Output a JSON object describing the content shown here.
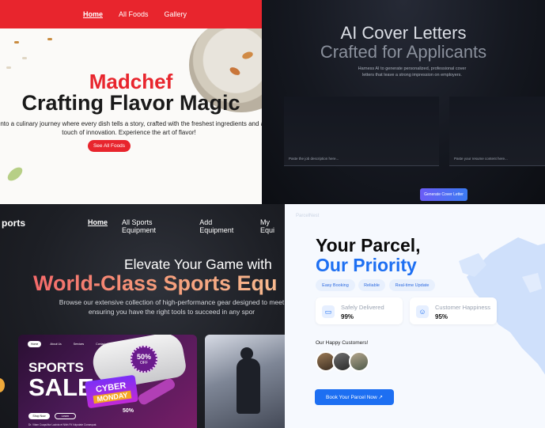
{
  "madchef": {
    "nav": [
      "Home",
      "All Foods",
      "Gallery"
    ],
    "title_line1": "Madchef",
    "title_line2": "Crafting Flavor Magic",
    "description": "e into a culinary journey where every dish tells a story, crafted with the freshest ingredients and a touch of innovation. Experience the art of flavor!",
    "cta": "See All Foods",
    "accent": "#e8252d"
  },
  "cover": {
    "title_line1": "AI Cover Letters",
    "title_line2": "Crafted for Applicants",
    "subtitle": "Harness AI to generate personalized, professional cover letters that leave a strong impression on employers.",
    "job_placeholder": "Paste the job description here...",
    "resume_placeholder": "Paste your resume content here...",
    "cta": "Generate Cover Letter"
  },
  "sports": {
    "brand": "ports",
    "nav": [
      "Home",
      "All Sports Equipment",
      "Add Equipment",
      "My Equi"
    ],
    "heading1": "Elevate Your Game with",
    "heading2": "World-Class Sports Equ",
    "description_line1": "Browse our extensive collection of high-performance gear designed to meet",
    "description_line2": "ensuring you have the right tools to succeed in any spor",
    "card": {
      "mini_nav": [
        "Home",
        "About Us",
        "Services",
        "Contact"
      ],
      "line1": "SPORTS",
      "line2": "SALE",
      "badge_value": "50%",
      "badge_label": "OFF",
      "cyber": "CYBER",
      "monday": "MONDAY",
      "discount": "50%",
      "cta1": "Shop Now",
      "cta2": "Learn",
      "fine": "Dr. Vitam Cuapulitur Lacinia et Nibh Fit Vulputate Consequat."
    }
  },
  "parcel": {
    "brand": "ParcelNest",
    "title_line1": "Your Parcel,",
    "title_line2": "Our Priority",
    "chips": [
      "Easy Booking",
      "Reliable",
      "Real-time Update"
    ],
    "stats": [
      {
        "label": "Safely Delivered",
        "value": "99%",
        "icon": "truck-icon"
      },
      {
        "label": "Customer Happiness",
        "value": "95%",
        "icon": "smile-icon"
      }
    ],
    "customers_label": "Our Happy Customers!",
    "cta": "Book Your Parcel Now ↗",
    "accent": "#1d6ff2"
  }
}
